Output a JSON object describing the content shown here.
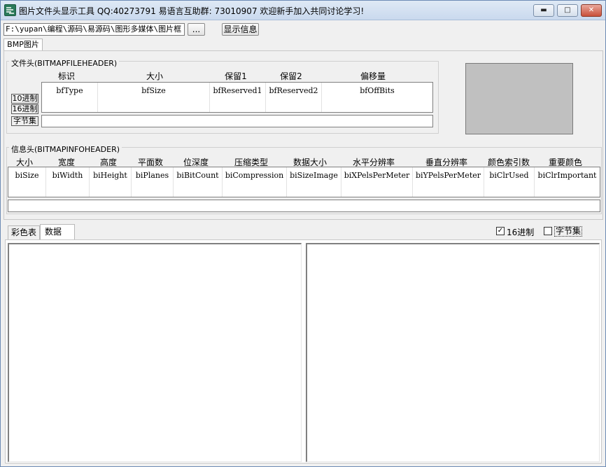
{
  "window": {
    "title": "图片文件头显示工具 QQ:40273791 易语言互助群: 73010907 欢迎新手加入共同讨论学习!",
    "min_label": "▬",
    "max_label": "□",
    "close_label": "✕"
  },
  "toolbar": {
    "path_value": "F:\\yupan\\编程\\源码\\易源码\\图形多媒体\\图片框",
    "browse_label": "...",
    "show_info_label": "显示信息"
  },
  "main_tab": {
    "label": "BMP图片"
  },
  "file_header": {
    "group_title": "文件头(BITMAPFILEHEADER)",
    "columns": [
      "标识",
      "大小",
      "保留1",
      "保留2",
      "偏移量"
    ],
    "fields": [
      "bfType",
      "bfSize",
      "bfReserved1",
      "bfReserved2",
      "bfOffBits"
    ],
    "dec_label": "10进制",
    "hex_label": "16进制",
    "bytes_label": "字节集"
  },
  "info_header": {
    "group_title": "信息头(BITMAPINFOHEADER)",
    "columns": [
      "大小",
      "宽度",
      "高度",
      "平面数",
      "位深度",
      "压缩类型",
      "数据大小",
      "水平分辨率",
      "垂直分辨率",
      "颜色索引数",
      "重要颜色"
    ],
    "fields": [
      "biSize",
      "biWidth",
      "biHeight",
      "biPlanes",
      "biBitCount",
      "biCompression",
      "biSizeImage",
      "biXPelsPerMeter",
      "biYPelsPerMeter",
      "biClrUsed",
      "biClrImportant"
    ]
  },
  "bottom_tabs": {
    "color_table": "彩色表",
    "data": "数据"
  },
  "options": {
    "hex_label": "16进制",
    "hex_checked": true,
    "bytes_label": "字节集",
    "bytes_checked": false,
    "check_mark": "✓"
  },
  "colors": {
    "titlebar": "#c9d9ee",
    "preview_fill": "#c0c0c0",
    "close_button": "#c9503a"
  }
}
